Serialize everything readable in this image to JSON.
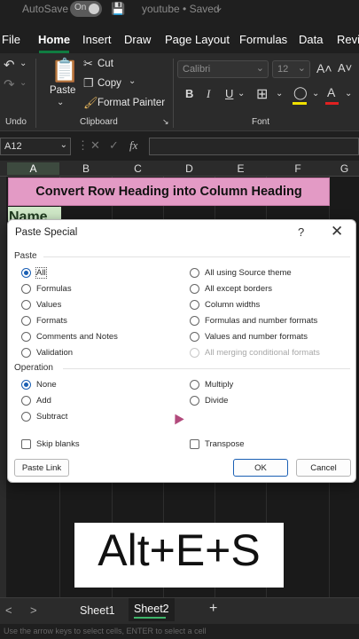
{
  "titlebar": {
    "autosave_label": "AutoSave",
    "toggle_state": "On",
    "document": "youtube • Saved",
    "chevron": "⌄"
  },
  "tabs": [
    "File",
    "Home",
    "Insert",
    "Draw",
    "Page Layout",
    "Formulas",
    "Data",
    "Revi"
  ],
  "ribbon": {
    "undo_label": "Undo",
    "clipboard_label": "Clipboard",
    "font_label": "Font",
    "paste_label": "Paste",
    "cut_label": "Cut",
    "copy_label": "Copy",
    "format_painter_label": "Format Painter",
    "font_name": "Calibri",
    "font_size": "12",
    "grow_font": "A˄",
    "shrink_font": "A˅",
    "bold": "B",
    "italic": "I",
    "underline": "U",
    "font_color": "A"
  },
  "formula_bar": {
    "name_box": "A12",
    "fx": "fx"
  },
  "columns": [
    "A",
    "B",
    "C",
    "D",
    "E",
    "F",
    "G"
  ],
  "sheet": {
    "banner": "Convert Row Heading into Column Heading",
    "name_cell": "Name"
  },
  "dialog": {
    "title": "Paste Special",
    "help": "?",
    "close": "✕",
    "paste_section": "Paste",
    "paste_options_left": [
      "All",
      "Formulas",
      "Values",
      "Formats",
      "Comments and Notes",
      "Validation"
    ],
    "paste_options_right": [
      "All using Source theme",
      "All except borders",
      "Column widths",
      "Formulas and number formats",
      "Values and number formats",
      "All merging conditional formats"
    ],
    "operation_section": "Operation",
    "operation_options_left": [
      "None",
      "Add",
      "Subtract"
    ],
    "operation_options_right": [
      "Multiply",
      "Divide"
    ],
    "skip_blanks": "Skip blanks",
    "transpose": "Transpose",
    "paste_link": "Paste Link",
    "ok": "OK",
    "cancel": "Cancel"
  },
  "shortcut": "Alt+E+S",
  "sheet_tabs": [
    "Sheet1",
    "Sheet2"
  ],
  "add_sheet": "+",
  "nav_prev": "<",
  "nav_next": ">",
  "status": "Use the arrow keys to select cells, ENTER to select a cell"
}
